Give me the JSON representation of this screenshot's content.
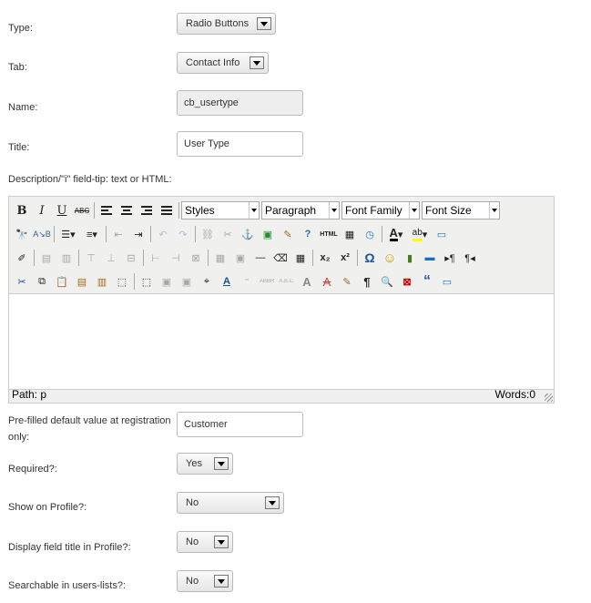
{
  "form": {
    "type": {
      "label": "Type:",
      "value": "Radio Buttons"
    },
    "tab": {
      "label": "Tab:",
      "value": "Contact Info"
    },
    "name": {
      "label": "Name:",
      "value": "cb_usertype"
    },
    "title": {
      "label": "Title:",
      "value": "User Type"
    },
    "description": {
      "label": "Description/\"i\" field-tip: text or HTML:"
    },
    "prefilled": {
      "label_line1": "Pre-filled default value at registration",
      "label_line2": "only:",
      "value": "Customer"
    },
    "required": {
      "label": "Required?:",
      "value": "Yes"
    },
    "show_on_profile": {
      "label": "Show on Profile?:",
      "value": "No"
    },
    "display_title": {
      "label": "Display field title in Profile?:",
      "value": "No"
    },
    "searchable": {
      "label": "Searchable in users-lists?:",
      "value": "No"
    }
  },
  "editor": {
    "dropdowns": {
      "styles": "Styles",
      "format": "Paragraph",
      "font_family": "Font Family",
      "font_size": "Font Size"
    },
    "buttons": {
      "bold": "B",
      "italic": "I",
      "underline": "U",
      "strike": "ABC",
      "html": "HTML",
      "omega": "Ω",
      "pilcrow": "¶",
      "quote": "“",
      "sub": "x₂",
      "sup": "x²"
    },
    "path": "Path: p",
    "words": "Words:0"
  },
  "colors": {
    "accent": "#1a6fc4",
    "editor_bg": "#f0f0ee"
  }
}
